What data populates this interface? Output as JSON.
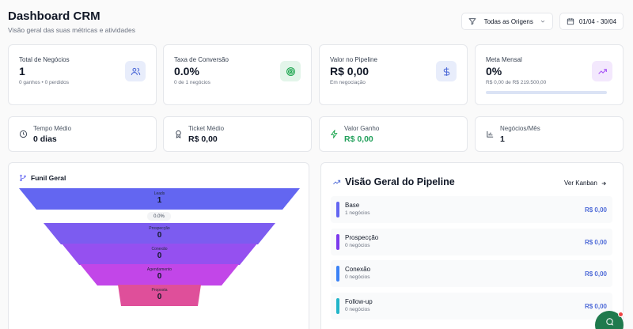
{
  "header": {
    "title": "Dashboard CRM",
    "subtitle": "Visão geral das suas métricas e atividades"
  },
  "filters": {
    "origin_label": "Todas as Origens",
    "date_range": "01/04 - 30/04"
  },
  "kpis": [
    {
      "label": "Total de Negócios",
      "value": "1",
      "sub": "0 ganhos • 0 perdidos",
      "icon": "users-icon",
      "color": "#4f6bd8"
    },
    {
      "label": "Taxa de Conversão",
      "value": "0.0%",
      "sub": "0 de 1 negócios",
      "icon": "target-icon",
      "color": "#16a34a"
    },
    {
      "label": "Valor no Pipeline",
      "value": "R$ 0,00",
      "sub": "Em negociação",
      "icon": "dollar-icon",
      "color": "#4f6bd8"
    },
    {
      "label": "Meta Mensal",
      "value": "0%",
      "sub": "R$ 0,00 de R$ 219.500,00",
      "icon": "trending-up-icon",
      "color": "#a855f7",
      "progress": 0
    }
  ],
  "stats": [
    {
      "label": "Tempo Médio",
      "value": "0 dias",
      "icon": "clock-icon"
    },
    {
      "label": "Ticket Médio",
      "value": "R$ 0,00",
      "icon": "award-icon"
    },
    {
      "label": "Valor Ganho",
      "value": "R$ 0,00",
      "icon": "zap-icon",
      "value_color": "#22a05b"
    },
    {
      "label": "Negócios/Mês",
      "value": "1",
      "icon": "bar-chart-icon"
    }
  ],
  "funnel": {
    "title": "Funil Geral",
    "conversion": "0.0%",
    "stages": [
      {
        "label": "Leads",
        "value": "1",
        "color": "#6366f1"
      },
      {
        "label": "Prospecção",
        "value": "0",
        "color": "#7c5cf0"
      },
      {
        "label": "Conexão",
        "value": "0",
        "color": "#9550f0"
      },
      {
        "label": "Agendamento",
        "value": "0",
        "color": "#c246e8"
      },
      {
        "label": "Proposta",
        "value": "0",
        "color": "#df4f9a"
      }
    ]
  },
  "pipeline": {
    "title": "Visão Geral do Pipeline",
    "link": "Ver Kanban",
    "rows": [
      {
        "name": "Base",
        "count": "1 negócios",
        "value": "R$ 0,00",
        "color": "#6366f1"
      },
      {
        "name": "Prospecção",
        "count": "0 negócios",
        "value": "R$ 0,00",
        "color": "#7c3aed"
      },
      {
        "name": "Conexão",
        "count": "0 negócios",
        "value": "R$ 0,00",
        "color": "#3b82f6"
      },
      {
        "name": "Follow-up",
        "count": "0 negócios",
        "value": "R$ 0,00",
        "color": "#22b5c9"
      }
    ]
  }
}
